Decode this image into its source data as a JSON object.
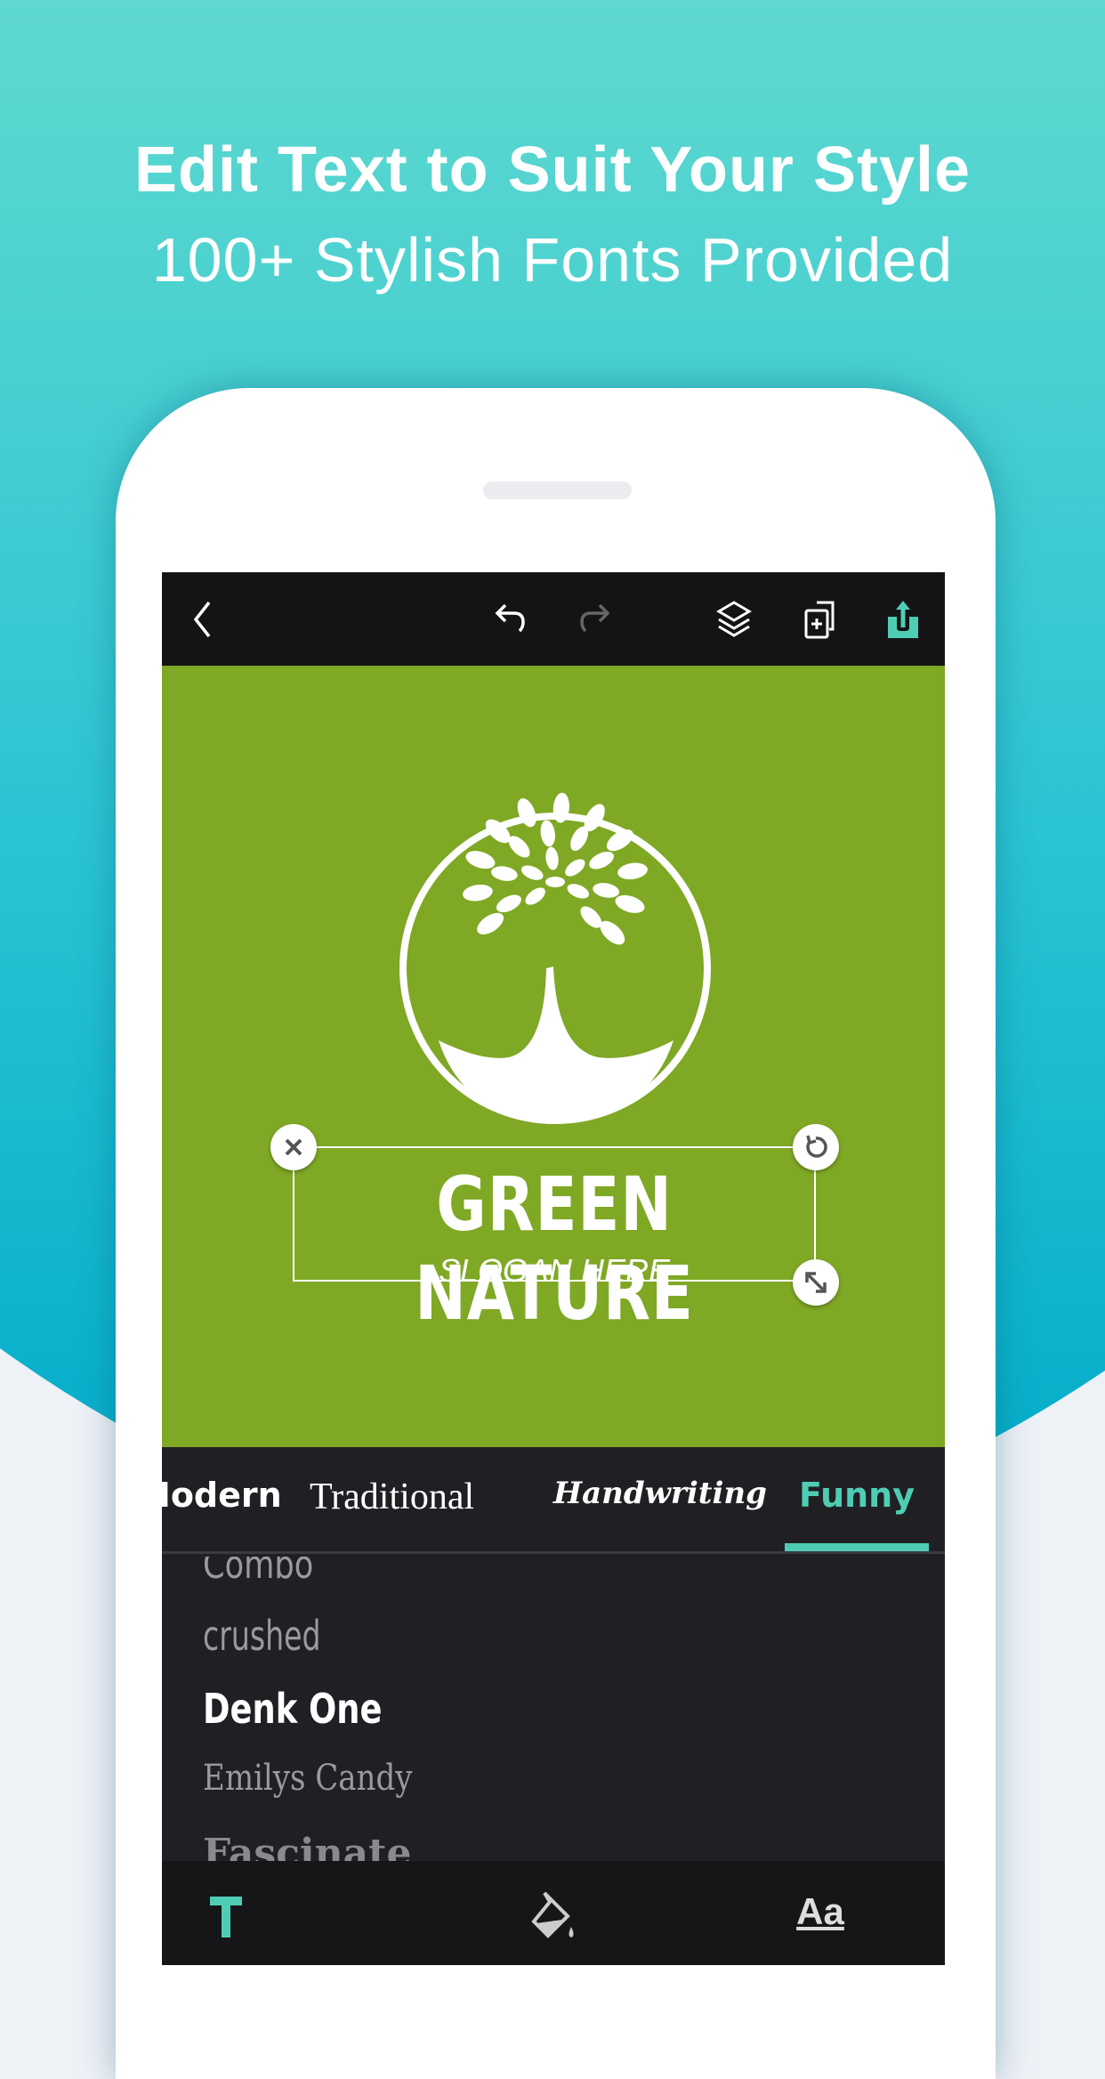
{
  "promo": {
    "headline": "Edit Text to Suit Your Style",
    "subheadline": "100+ Stylish Fonts Provided"
  },
  "toolbar": {
    "icons": [
      "back-icon",
      "undo-icon",
      "redo-icon",
      "layers-icon",
      "duplicate-icon",
      "share-icon"
    ]
  },
  "canvas": {
    "background_color": "#7fa825",
    "title_text": "GREEN NATURE",
    "slogan_text": "SLOGAN HERE"
  },
  "font_tabs": {
    "items": [
      {
        "label": "Modern",
        "visible_text": "odern"
      },
      {
        "label": "Traditional"
      },
      {
        "label": "Handwriting"
      },
      {
        "label": "Funny",
        "selected": true
      }
    ],
    "accent_color": "#4ecdb4"
  },
  "font_list": {
    "items": [
      {
        "label": "Combo"
      },
      {
        "label": "Crushed"
      },
      {
        "label": "Denk One",
        "selected": true
      },
      {
        "label": "Emilys Candy"
      },
      {
        "label": "Fascinate"
      }
    ]
  },
  "bottom_nav": {
    "items": [
      {
        "icon": "text-icon",
        "label": "T",
        "active": true
      },
      {
        "icon": "paint-bucket-icon"
      },
      {
        "icon": "font-icon",
        "label": "Aa"
      }
    ]
  }
}
